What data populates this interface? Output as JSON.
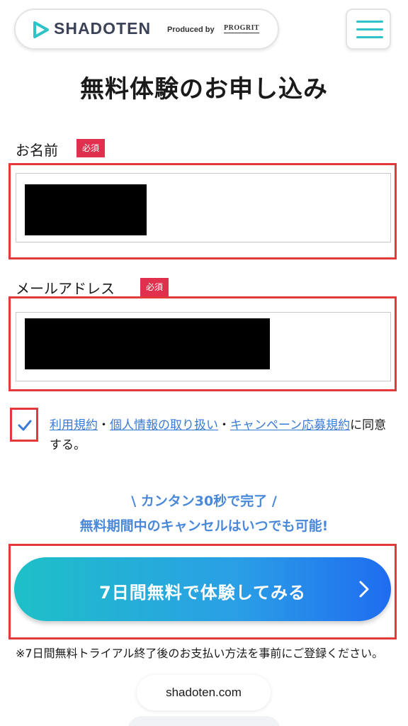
{
  "header": {
    "logo_text": "SHADOTEN",
    "produced_by": "Produced by",
    "partner_logo": "PROGRIT",
    "logo_icon": "play-triangle-icon",
    "menu_icon": "hamburger-menu-icon"
  },
  "form": {
    "title": "無料体験のお申し込み",
    "name_label": "お名前",
    "email_label": "メールアドレス",
    "required_badge": "必須",
    "agree_links": [
      "利用規約",
      "個人情報の取り扱い",
      "キャンペーン応募規約"
    ],
    "agree_separator": "・",
    "agree_suffix": "に同意する。",
    "checkbox_checked": true
  },
  "promo": {
    "line1": "\\ カンタン30秒で完了 /",
    "line2": "無料期間中のキャンセルはいつでも可能!"
  },
  "cta": {
    "label": "7日間無料で体験してみる",
    "arrow_icon": "chevron-right-icon"
  },
  "note": "※7日間無料トライアル終了後のお支払い方法を事前にご登録ください。",
  "browser": {
    "url": "shadoten.com"
  },
  "colors": {
    "brand_teal": "#2fc2c8",
    "required_red": "#e0304e",
    "link_blue": "#3a7bd5",
    "highlight_red": "#e23a3a"
  }
}
